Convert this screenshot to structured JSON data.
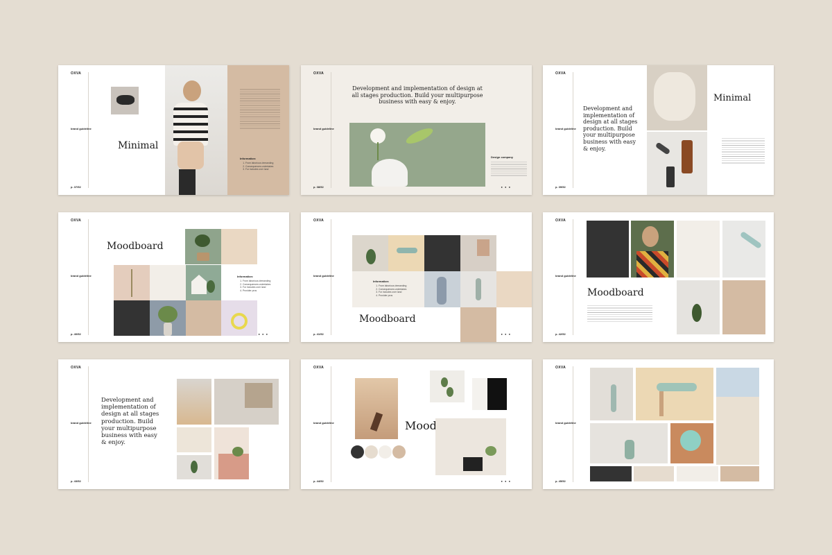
{
  "brand": "OXVA",
  "sidebar_label": "brand guideline",
  "slides": [
    {
      "page": "p. 37/52",
      "title": "Minimal",
      "info_title": "Information:",
      "info_items": [
        "From laborious demanding",
        "Consequences undertakes",
        "For includes over land"
      ]
    },
    {
      "page": "p. 38/52",
      "heading": "Development and implementation of design at all stages production. Build your multipurpose business with easy & enjoy.",
      "caption_title": "Design company"
    },
    {
      "page": "p. 39/52",
      "title": "Minimal",
      "heading": "Development and implementation of design at all stages production. Build your multipurpose business with easy & enjoy."
    },
    {
      "page": "p. 40/52",
      "title": "Moodboard",
      "info_title": "Information:",
      "info_items": [
        "From laborious demanding",
        "Consequences undertakes",
        "For includes over land",
        "Provider pros"
      ]
    },
    {
      "page": "p. 41/52",
      "title": "Moodboard",
      "info_title": "Information:",
      "info_items": [
        "From laborious demanding",
        "Consequences undertakes",
        "For includes over land",
        "Provider pros"
      ]
    },
    {
      "page": "p. 42/52",
      "title": "Moodboard"
    },
    {
      "page": "p. 43/52",
      "heading": "Development and implementation of design at all stages production. Build your multipurpose business with easy & enjoy."
    },
    {
      "page": "p. 44/52",
      "title": "Mood"
    },
    {
      "page": "p. 45/52"
    }
  ],
  "colors": {
    "background": "#e4ddd2",
    "beige": "#d4bba3",
    "cream": "#f2eee8",
    "dark": "#333333",
    "sage": "#95a78c"
  }
}
